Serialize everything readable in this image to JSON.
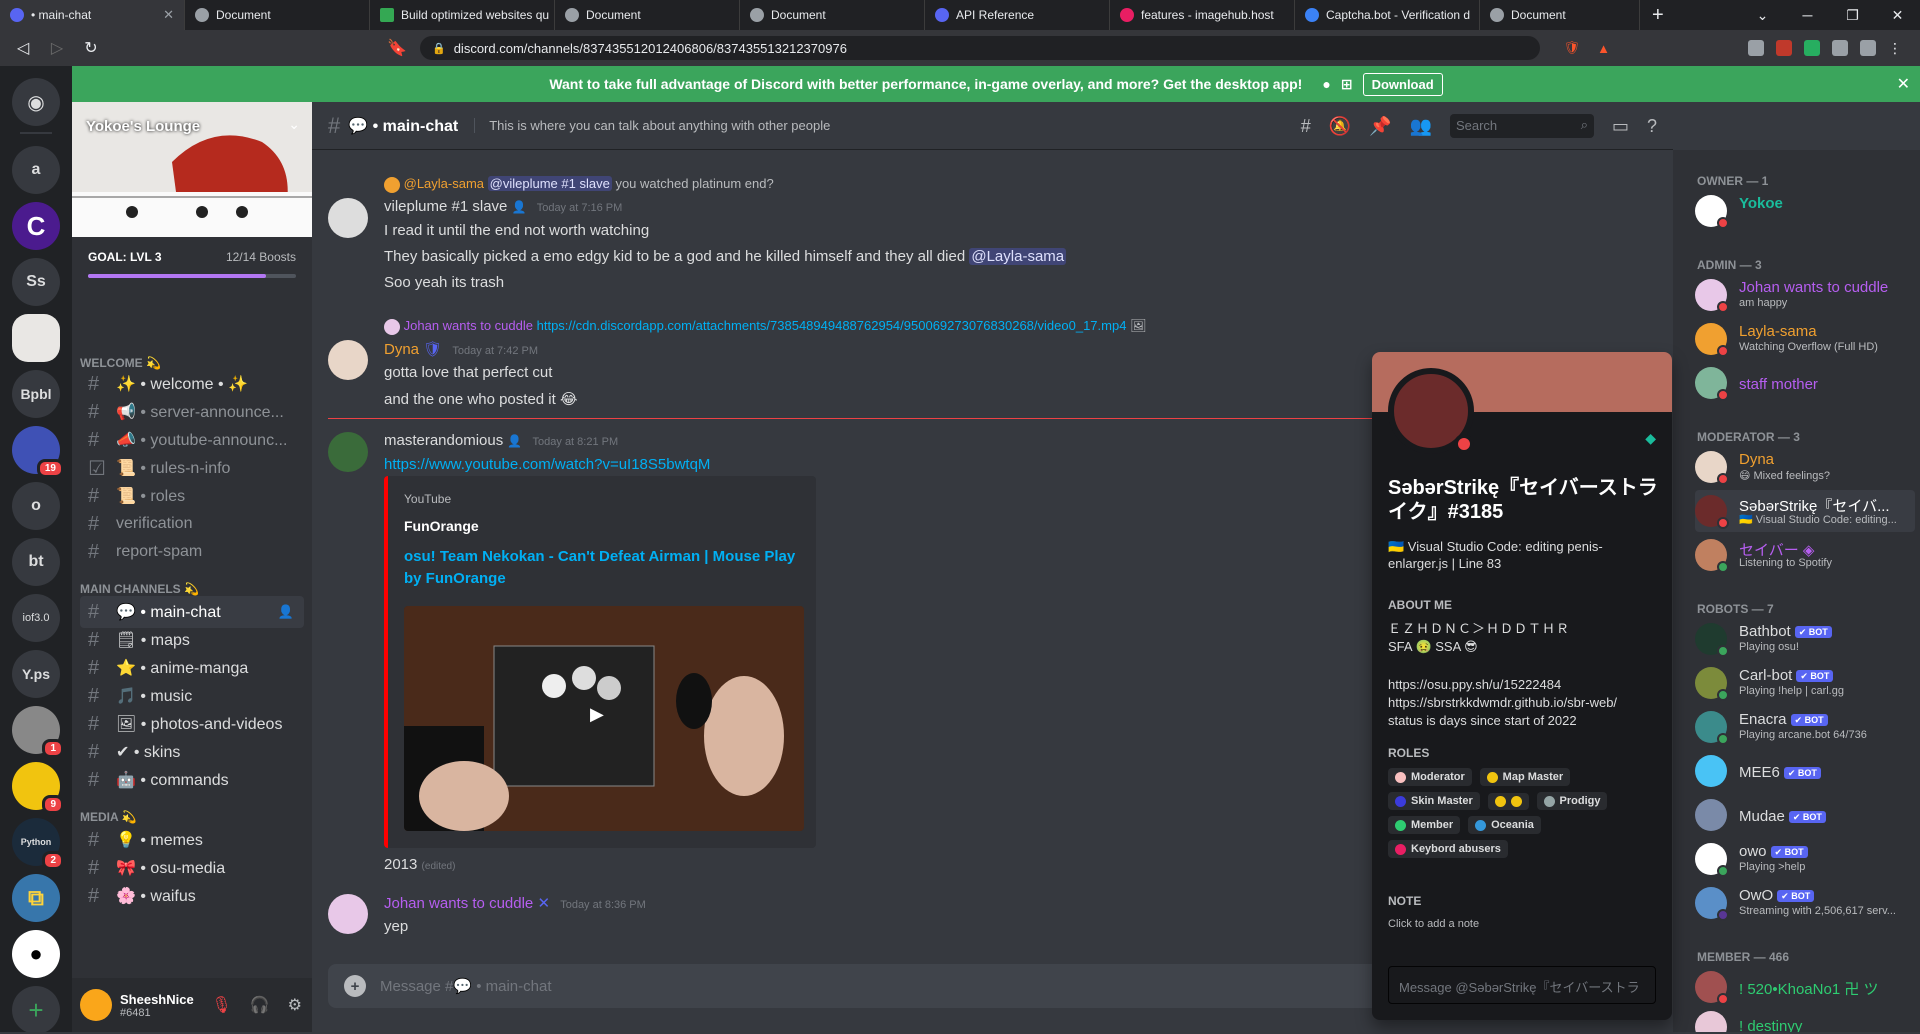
{
  "browser": {
    "tabs": [
      {
        "label": "• main-chat",
        "active": true
      },
      {
        "label": "Document"
      },
      {
        "label": "Build optimized websites qu"
      },
      {
        "label": "Document"
      },
      {
        "label": "Document"
      },
      {
        "label": "API Reference"
      },
      {
        "label": "features - imagehub.host"
      },
      {
        "label": "Captcha.bot - Verification d"
      },
      {
        "label": "Document"
      }
    ],
    "url": "discord.com/channels/837435512012406806/837435513212370976"
  },
  "banner": {
    "text": "Want to take full advantage of Discord with better performance, in-game overlay, and more? Get the desktop app!",
    "button": "Download"
  },
  "guilds": [
    {
      "label": "a"
    },
    {
      "label": "C"
    },
    {
      "label": "Ss"
    },
    {
      "label": ""
    },
    {
      "label": "Bpbl"
    },
    {
      "label": "",
      "badge": "19"
    },
    {
      "label": "o"
    },
    {
      "label": "bt"
    },
    {
      "label": "iof3.0"
    },
    {
      "label": "Y.ps"
    },
    {
      "label": "",
      "badge": "1"
    },
    {
      "label": "",
      "badge": "9"
    },
    {
      "label": "Python",
      "badge": "2"
    },
    {
      "label": ""
    },
    {
      "label": ""
    },
    {
      "label": "+"
    }
  ],
  "server": {
    "name": "Yokoe's Lounge",
    "goal": "GOAL: LVL 3",
    "boosts": "12/14 Boosts",
    "boost_progress": 0.857
  },
  "channels": {
    "cat_welcome": "WELCOME 💫",
    "welcome": "✨ • welcome • ✨",
    "server_announce": "📢 • server-announce...",
    "youtube_announce": "📣 • youtube-announc...",
    "rules": "📜 • rules-n-info",
    "roles": "📜 • roles",
    "verification": "verification",
    "report_spam": "report-spam",
    "cat_main": "MAIN CHANNELS 💫",
    "main_chat": "💬 • main-chat",
    "maps": "🗒 • maps",
    "anime_manga": "⭐ • anime-manga",
    "music": "🎵 • music",
    "photos": "🖼 • photos-and-videos",
    "skins": "✔ • skins",
    "commands": "🤖 • commands",
    "cat_media": "MEDIA 💫",
    "memes": "💡 • memes",
    "osu_media": "🎀 • osu-media",
    "waifus": "🌸 • waifus"
  },
  "user": {
    "name": "SheeshNice",
    "tag": "#6481"
  },
  "header": {
    "channel": "💬 • main-chat",
    "topic": "This is where you can talk about anything with other people",
    "search_placeholder": "Search"
  },
  "messages": {
    "m1_reply_author": "@Layla-sama",
    "m1_reply_mention": "@vileplume #1 slave",
    "m1_reply_text": "you watched platinum end?",
    "m1_author": "vileplume #1 slave",
    "m1_time": "Today at 7:16 PM",
    "m1_l1": "I read it until the end not worth watching",
    "m1_l2": "They basically picked a emo edgy kid to be a god and he killed himself and they all died",
    "m1_l2_mention": "@Layla-sama",
    "m1_l3": "Soo yeah its trash",
    "m2_reply_author": "Johan wants to cuddle",
    "m2_reply_link": "https://cdn.discordapp.com/attachments/738548949488762954/950069273076830268/video0_17.mp4",
    "m2_author": "Dyna",
    "m2_time": "Today at 7:42 PM",
    "m2_l1": "gotta love that perfect cut",
    "m2_l2": "and the one who posted it 😂",
    "m3_author": "masterandomious",
    "m3_time": "Today at 8:21 PM",
    "m3_link": "https://www.youtube.com/watch?v=uI18S5bwtqM",
    "embed_provider": "YouTube",
    "embed_author": "FunOrange",
    "embed_title": "osu! Team Nekokan - Can't Defeat Airman | Mouse Play by FunOrange",
    "m3_after": "2013",
    "m3_edited": "(edited)",
    "m4_author": "Johan wants to cuddle",
    "m4_time": "Today at 8:36 PM",
    "m4_l1": "yep"
  },
  "composer": {
    "placeholder": "Message #💬 • main-chat"
  },
  "members": {
    "owner_cat": "OWNER — 1",
    "admin_cat": "ADMIN — 3",
    "mod_cat": "MODERATOR — 3",
    "robots_cat": "ROBOTS — 7",
    "member_cat": "MEMBER — 466",
    "list": [
      {
        "name": "Yokoe",
        "status": "",
        "color": "#1abc9c"
      },
      {
        "name": "Johan wants to cuddle",
        "status": "am happy",
        "color": "#b65ef0"
      },
      {
        "name": "Layla-sama",
        "status": "Watching Overflow (Full HD)",
        "color": "#f0a030"
      },
      {
        "name": "staff mother",
        "status": "",
        "color": "#b65ef0"
      },
      {
        "name": "Dyna",
        "status": "😄 Mixed feelings?",
        "color": "#f0a030"
      },
      {
        "name": "SəbərStrikę『セイバ...",
        "status": "🇺🇦 Visual Studio Code: editing...",
        "color": "#ffffff"
      },
      {
        "name": "セイバー ◈",
        "status": "Listening to Spotify",
        "color": "#b65ef0"
      },
      {
        "name": "Bathbot",
        "status": "Playing osu!",
        "color": "#dcddde"
      },
      {
        "name": "Carl-bot",
        "status": "Playing !help | carl.gg",
        "color": "#dcddde"
      },
      {
        "name": "Enacra",
        "status": "Playing arcane.bot 64/736",
        "color": "#dcddde"
      },
      {
        "name": "MEE6",
        "status": "",
        "color": "#dcddde"
      },
      {
        "name": "Mudae",
        "status": "",
        "color": "#dcddde"
      },
      {
        "name": "owo",
        "status": "Playing >help",
        "color": "#dcddde"
      },
      {
        "name": "OwO",
        "status": "Streaming with 2,506,617 serv...",
        "color": "#dcddde"
      },
      {
        "name": "! 520•KhoaNo1 卍 ツ",
        "status": "",
        "color": "#2ecc71"
      },
      {
        "name": "! destinyy",
        "status": "",
        "color": "#2ecc71"
      }
    ],
    "bot_tag": "✔ BOT"
  },
  "popout": {
    "name": "SəbərStrikę『セイバーストライク』#3185",
    "custom_status": "🇺🇦 Visual Studio Code: editing penis-enlarger.js | Line 83",
    "about_label": "ABOUT ME",
    "about_l1": "ＥＺＨＤＮＣ＞ＨＤＤＴＨＲ",
    "about_l2": "SFA 🤢 SSA 😎",
    "about_link1": "https://osu.ppy.sh/u/15222484",
    "about_link2": "https://sbrstrkkdwmdr.github.io/sbr-web/",
    "about_l3": "status is days since start of 2022",
    "roles_label": "ROLES",
    "roles": [
      {
        "name": "Moderator",
        "color": "#f9c0c0"
      },
      {
        "name": "Map Master",
        "color": "#f1c40f"
      },
      {
        "name": "Skin Master",
        "color": "#3b3bdb"
      },
      {
        "name": "",
        "color": "#f1c40f"
      },
      {
        "name": "Prodigy",
        "color": "#95a5a6"
      },
      {
        "name": "Member",
        "color": "#2ecc71"
      },
      {
        "name": "Oceania",
        "color": "#3498db"
      },
      {
        "name": "Keybord abusers",
        "color": "#e91e63"
      }
    ],
    "note_label": "NOTE",
    "note_placeholder": "Click to add a note",
    "message_placeholder": "Message @SəbərStrikę『セイバーストラ"
  }
}
